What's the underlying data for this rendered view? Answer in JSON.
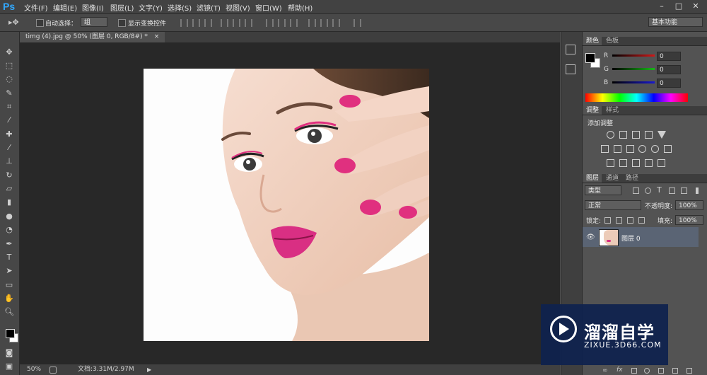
{
  "app": {
    "logo": "Ps"
  },
  "menu": [
    "文件(F)",
    "编辑(E)",
    "图像(I)",
    "图层(L)",
    "文字(Y)",
    "选择(S)",
    "滤镜(T)",
    "视图(V)",
    "窗口(W)",
    "帮助(H)"
  ],
  "window_controls": [
    "–",
    "□",
    "✕"
  ],
  "options": {
    "auto_select_label": "自动选择：",
    "auto_select_value": "组",
    "show_transform_label": "显示变换控件",
    "workspace": "基本功能"
  },
  "document": {
    "tab_title": "timg (4).jpg @ 50% (图层 0, RGB/8#) *",
    "tab_close": "×",
    "zoom": "50%",
    "doc_info": "文档:3.31M/2.97M"
  },
  "color_panel": {
    "tabs": [
      "颜色",
      "色板"
    ],
    "channels": [
      {
        "label": "R",
        "value": "0",
        "color": "#d01818"
      },
      {
        "label": "G",
        "value": "0",
        "color": "#18b818"
      },
      {
        "label": "B",
        "value": "0",
        "color": "#1818d0"
      }
    ]
  },
  "adjust_panel": {
    "tabs": [
      "调整",
      "样式"
    ],
    "heading": "添加调整"
  },
  "layers_panel": {
    "tabs": [
      "图层",
      "通道",
      "路径"
    ],
    "filter_kind": "类型",
    "blend_mode": "正常",
    "opacity_label": "不透明度:",
    "opacity": "100%",
    "lock_label": "锁定:",
    "fill_label": "填充:",
    "fill": "100%",
    "layer_name": "图层 0"
  },
  "watermark": {
    "title": "溜溜自学",
    "url": "ZIXUE.3D66.COM"
  },
  "colors": {
    "accent": "#31a8ff",
    "layer_selected": "#5a6474",
    "nail_pink": "#e0307f"
  }
}
